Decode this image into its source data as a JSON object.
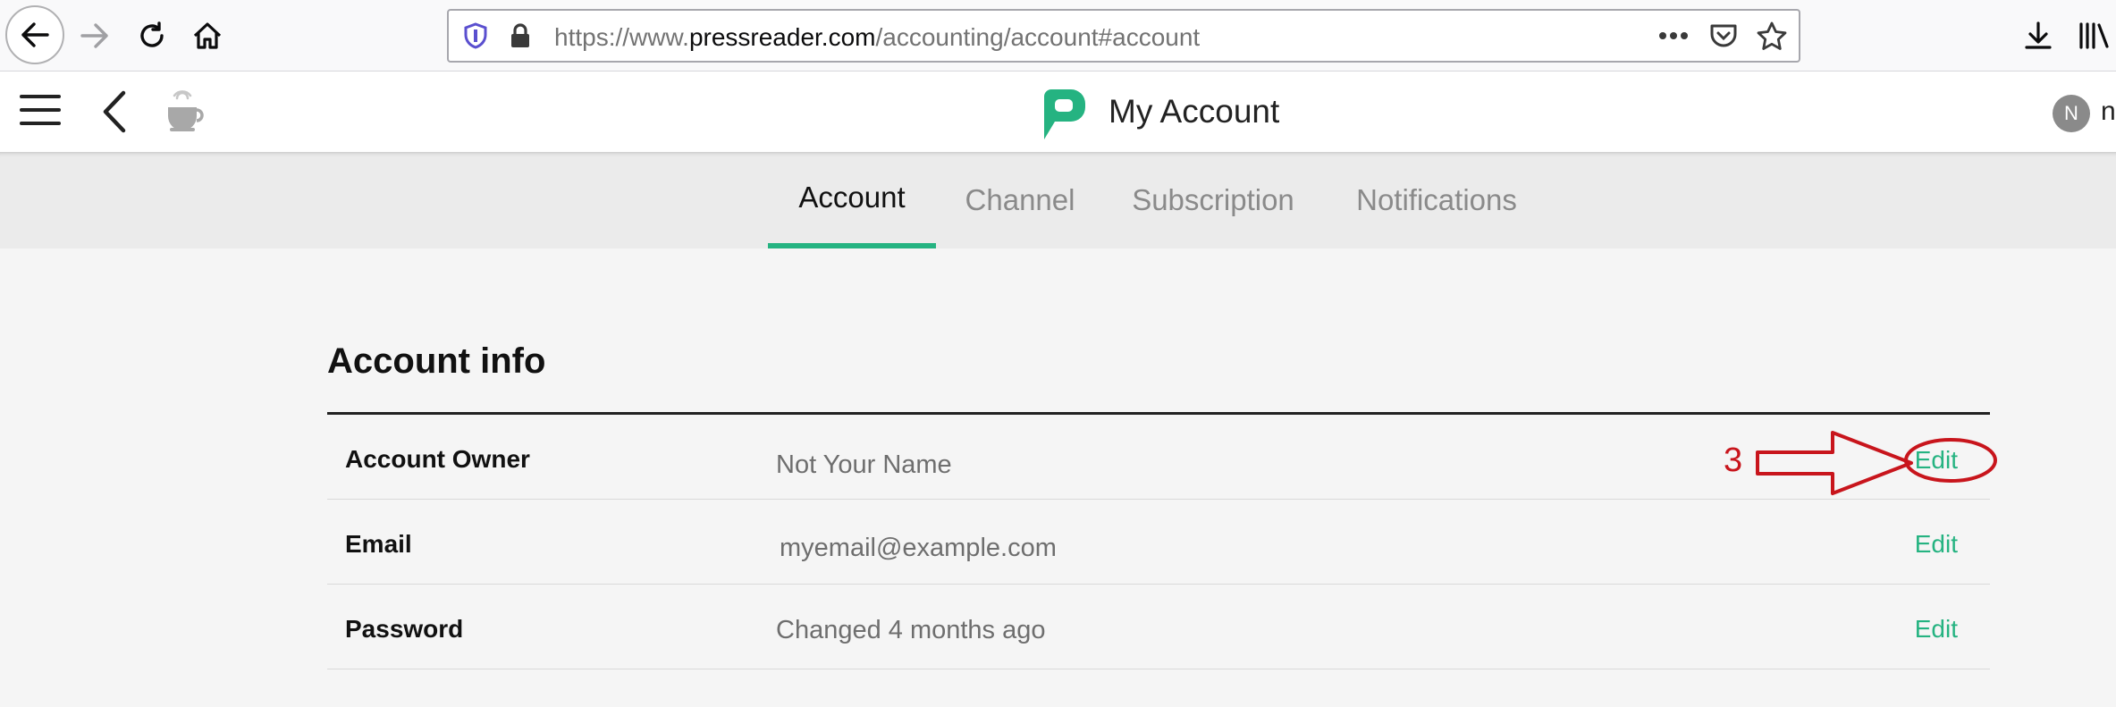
{
  "browser": {
    "url_prefix": "https://www.",
    "url_domain": "pressreader.com",
    "url_path": "/accounting/account#account",
    "icons": [
      "back-arrow-icon",
      "forward-arrow-icon",
      "reload-icon",
      "home-icon",
      "shield-icon",
      "lock-icon",
      "more-icon",
      "pocket-icon",
      "star-icon",
      "download-icon",
      "library-icon"
    ]
  },
  "header": {
    "title": "My Account",
    "avatar_initial": "N",
    "username_visible": "n",
    "brand_color": "#25b381"
  },
  "tabs": [
    {
      "label": "Account",
      "active": true
    },
    {
      "label": "Channel",
      "active": false
    },
    {
      "label": "Subscription",
      "active": false
    },
    {
      "label": "Notifications",
      "active": false
    }
  ],
  "account_info": {
    "title": "Account info",
    "rows": [
      {
        "label": "Account Owner",
        "value": "Not Your Name",
        "action": "Edit"
      },
      {
        "label": "Email",
        "value": "myemail@example.com",
        "action": "Edit"
      },
      {
        "label": "Password",
        "value": "Changed 4 months ago",
        "action": "Edit"
      }
    ]
  },
  "annotation": {
    "number": "3",
    "color": "#c8151c"
  }
}
